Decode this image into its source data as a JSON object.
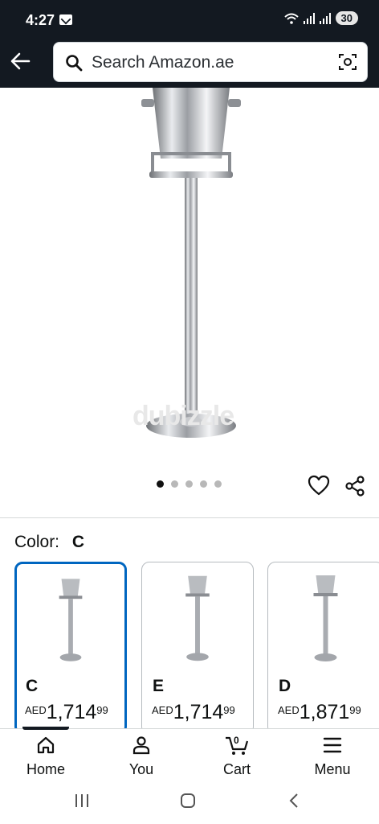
{
  "status_bar": {
    "time": "4:27",
    "battery": "30"
  },
  "header": {
    "search_placeholder": "Search Amazon.ae"
  },
  "product_image": {
    "watermark": "dubizzle",
    "carousel_count": 5,
    "carousel_active": 1
  },
  "color_section": {
    "label": "Color:",
    "selected": "C",
    "options": [
      {
        "name": "C",
        "currency": "AED",
        "whole": "1,714",
        "fraction": "99",
        "selected": true
      },
      {
        "name": "E",
        "currency": "AED",
        "whole": "1,714",
        "fraction": "99",
        "selected": false
      },
      {
        "name": "D",
        "currency": "AED",
        "whole": "1,871",
        "fraction": "99",
        "selected": false
      }
    ]
  },
  "bottom_nav": {
    "items": [
      {
        "label": "Home",
        "icon": "home-icon",
        "active": true
      },
      {
        "label": "You",
        "icon": "user-icon"
      },
      {
        "label": "Cart",
        "icon": "cart-icon",
        "count": "0"
      },
      {
        "label": "Menu",
        "icon": "menu-icon"
      }
    ]
  },
  "colors": {
    "header_bg": "#131921",
    "selected_border": "#0066c0"
  }
}
